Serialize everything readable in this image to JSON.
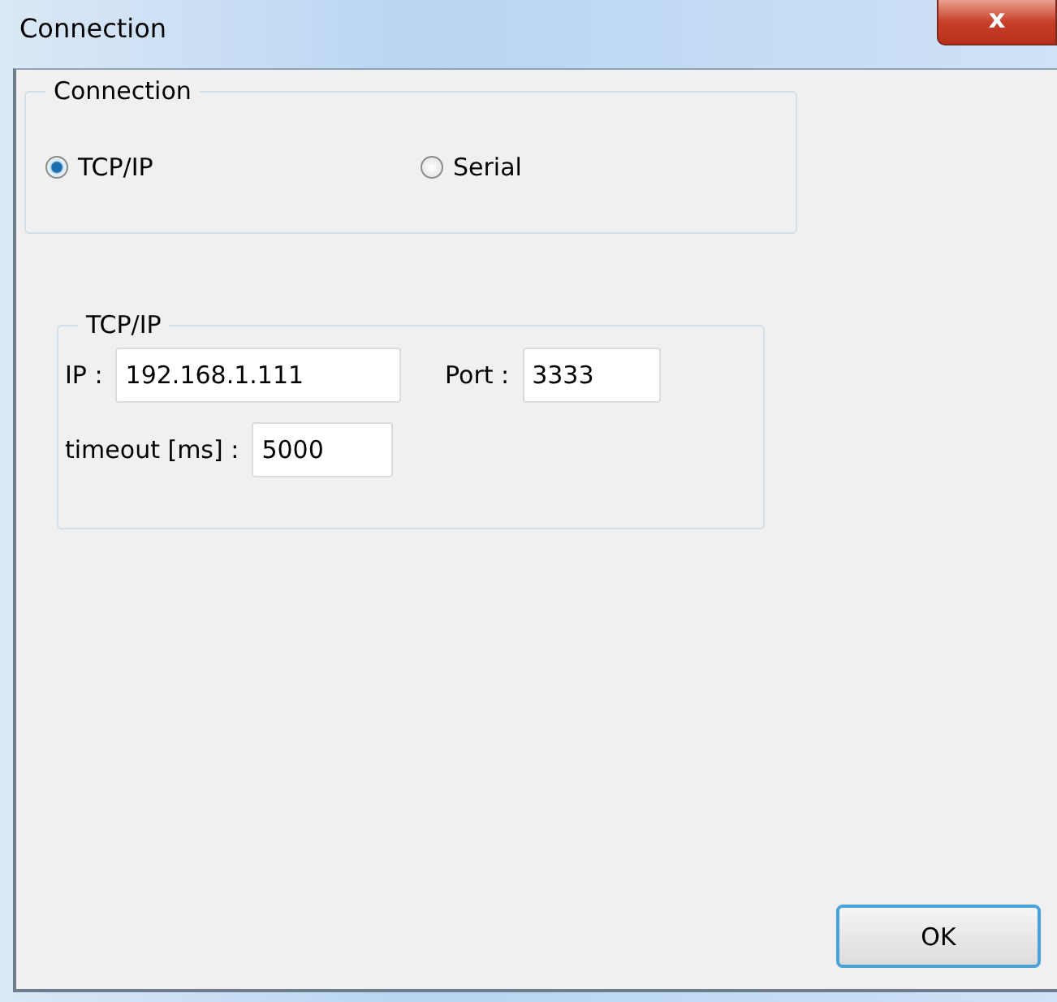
{
  "window": {
    "title": "Connection",
    "close": "x"
  },
  "connection_group": {
    "title": "Connection",
    "options": [
      {
        "label": "TCP/IP",
        "selected": true
      },
      {
        "label": "Serial",
        "selected": false
      }
    ]
  },
  "tcpip_group": {
    "title": "TCP/IP",
    "fields": [
      {
        "label": "IP :",
        "value": "192.168.1.111",
        "kind": "ip"
      },
      {
        "label": "Port :",
        "value": "3333",
        "kind": "port"
      },
      {
        "label": "timeout [ms] :",
        "value": "5000",
        "kind": "timeout"
      }
    ]
  },
  "buttons": [
    {
      "label": "OK"
    }
  ]
}
